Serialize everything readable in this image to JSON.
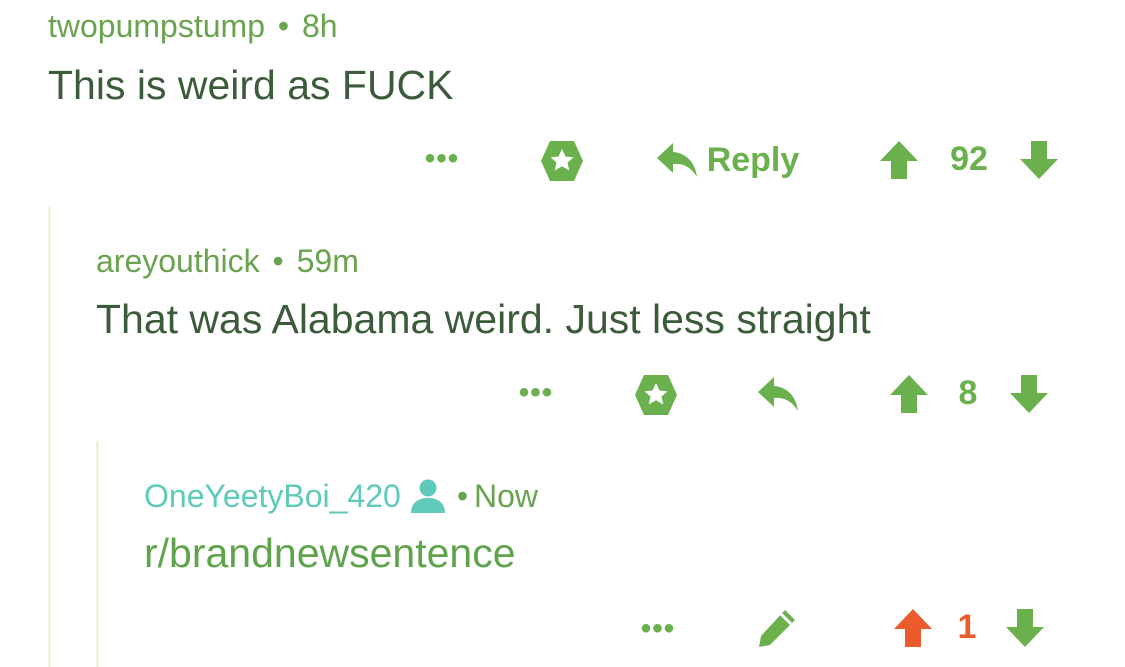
{
  "colors": {
    "green_text": "#3c5b3a",
    "green_accent": "#6ab04c",
    "green_meta": "#6aa34f",
    "teal": "#5fcab9",
    "orange": "#ec5b2c",
    "thread_line": "#eef3df"
  },
  "comments": [
    {
      "author": "twopumpstump",
      "separator": "•",
      "time": "8h",
      "body": "This is weird as FUCK",
      "actions": {
        "more": "•••",
        "award_icon": "award-icon",
        "reply_label": "Reply",
        "score": "92"
      }
    },
    {
      "author": "areyouthick",
      "separator": "•",
      "time": "59m",
      "body": "That was Alabama weird. Just less straight",
      "actions": {
        "more": "•••",
        "award_icon": "award-icon",
        "score": "8"
      }
    },
    {
      "author": "OneYeetyBoi_420",
      "separator": "•",
      "time": "Now",
      "body": "r/brandnewsentence",
      "actions": {
        "more": "•••",
        "edit_icon": "pencil-icon",
        "score": "1",
        "upvoted": true
      }
    }
  ]
}
